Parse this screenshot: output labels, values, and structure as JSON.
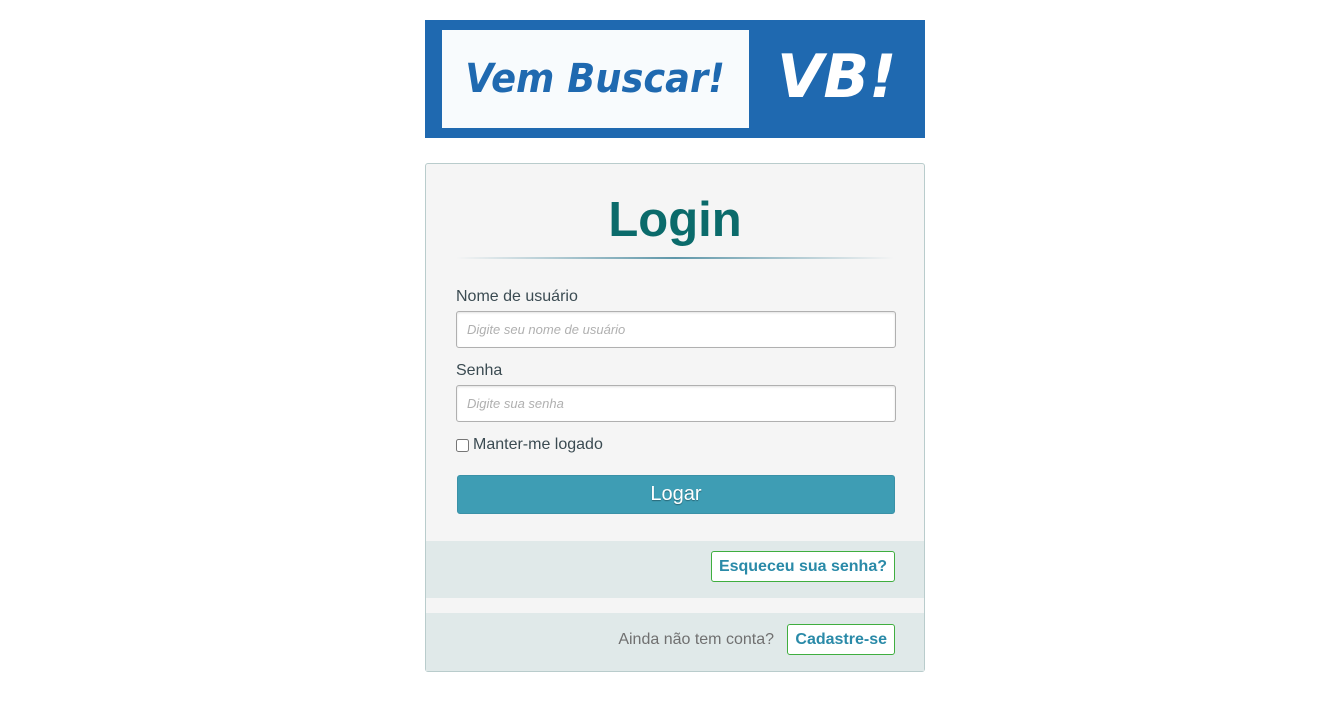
{
  "logo": {
    "text": "Vem Buscar!",
    "abbr": "VB!"
  },
  "login": {
    "title": "Login",
    "username_label": "Nome de usuário",
    "username_placeholder": "Digite seu nome de usuário",
    "username_value": "",
    "password_label": "Senha",
    "password_placeholder": "Digite sua senha",
    "password_value": "",
    "remember_label": "Manter-me logado",
    "remember_checked": false,
    "submit_label": "Logar"
  },
  "forgot": {
    "link_label": "Esqueceu sua senha?"
  },
  "signup": {
    "prompt": "Ainda não tem conta?",
    "link_label": "Cadastre-se"
  },
  "colors": {
    "brand_blue": "#1f69b0",
    "title_teal": "#0b6b6b",
    "button_teal": "#3e9db4",
    "link_border_green": "#3fae3f"
  }
}
